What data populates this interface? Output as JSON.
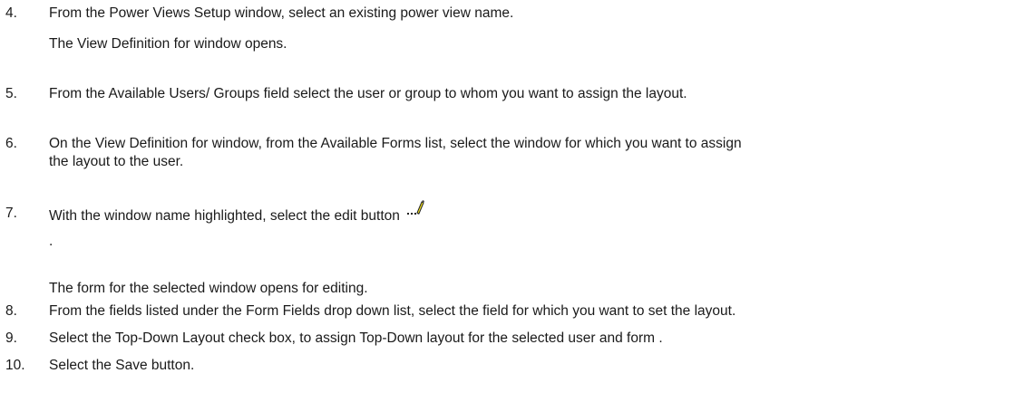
{
  "steps": [
    {
      "num": "4.",
      "text": "From the Power Views Setup window,  select an existing power view name.",
      "sub": "The View Definition for window opens."
    },
    {
      "num": "5.",
      "text": "From the Available Users/ Groups field select the user or group to whom you want to assign the layout."
    },
    {
      "num": "6.",
      "text": "On the View Definition for window, from the Available Forms list, select the window for which you want to assign",
      "cont": "the layout to the user."
    },
    {
      "num": "7.",
      "text": "With the window name highlighted, select the edit button",
      "icon": "edit-pencil-icon",
      "after": ".",
      "sub": "The form for the selected window opens for editing."
    },
    {
      "num": "8.",
      "text": "From the fields listed under the Form Fields drop down list, select the field for which you want to set the layout."
    },
    {
      "num": "9.",
      "text": "Select the Top-Down Layout check box, to assign Top-Down layout for the selected user and form ."
    },
    {
      "num": "10.",
      "text": "Select the Save button."
    }
  ]
}
